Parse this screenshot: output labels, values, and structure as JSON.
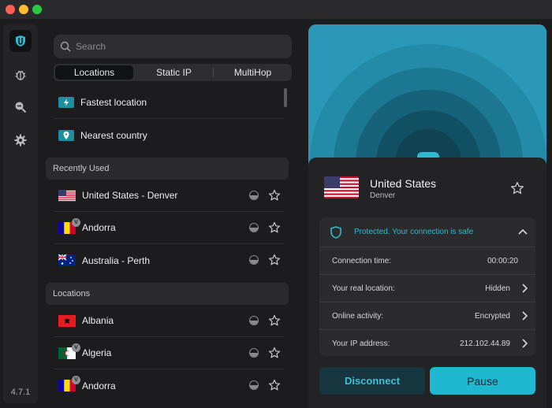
{
  "app": {
    "version": "4.7.1"
  },
  "colors": {
    "accent": "#1fb8d0",
    "protected": "#2fb8cf",
    "background": "#1c1c1e"
  },
  "rail": {
    "icons": [
      "shield-logo-icon",
      "bug-icon",
      "search-zoom-icon",
      "gear-icon"
    ]
  },
  "search": {
    "placeholder": "Search",
    "value": ""
  },
  "tabs": [
    {
      "label": "Locations",
      "active": true
    },
    {
      "label": "Static IP",
      "active": false
    },
    {
      "label": "MultiHop",
      "active": false
    }
  ],
  "quick": [
    {
      "label": "Fastest location",
      "icon": "lightning-icon"
    },
    {
      "label": "Nearest country",
      "icon": "pin-icon"
    }
  ],
  "recent": {
    "header": "Recently Used",
    "items": [
      {
        "label": "United States - Denver",
        "flag": "us"
      },
      {
        "label": "Andorra",
        "flag": "ad",
        "virtual": "V"
      },
      {
        "label": "Australia - Perth",
        "flag": "au"
      }
    ]
  },
  "locations": {
    "header": "Locations",
    "items": [
      {
        "label": "Albania",
        "flag": "al"
      },
      {
        "label": "Algeria",
        "flag": "dz",
        "virtual": "V"
      },
      {
        "label": "Andorra",
        "flag": "ad",
        "virtual": "V"
      }
    ]
  },
  "connection": {
    "country": "United States",
    "city": "Denver",
    "status": "Protected. Your connection is safe",
    "rows": [
      {
        "key": "Connection time:",
        "value": "00:00:20"
      },
      {
        "key": "Your real location:",
        "value": "Hidden"
      },
      {
        "key": "Online activity:",
        "value": "Encrypted"
      },
      {
        "key": "Your IP address:",
        "value": "212.102.44.89"
      }
    ],
    "disconnect_label": "Disconnect",
    "pause_label": "Pause"
  }
}
